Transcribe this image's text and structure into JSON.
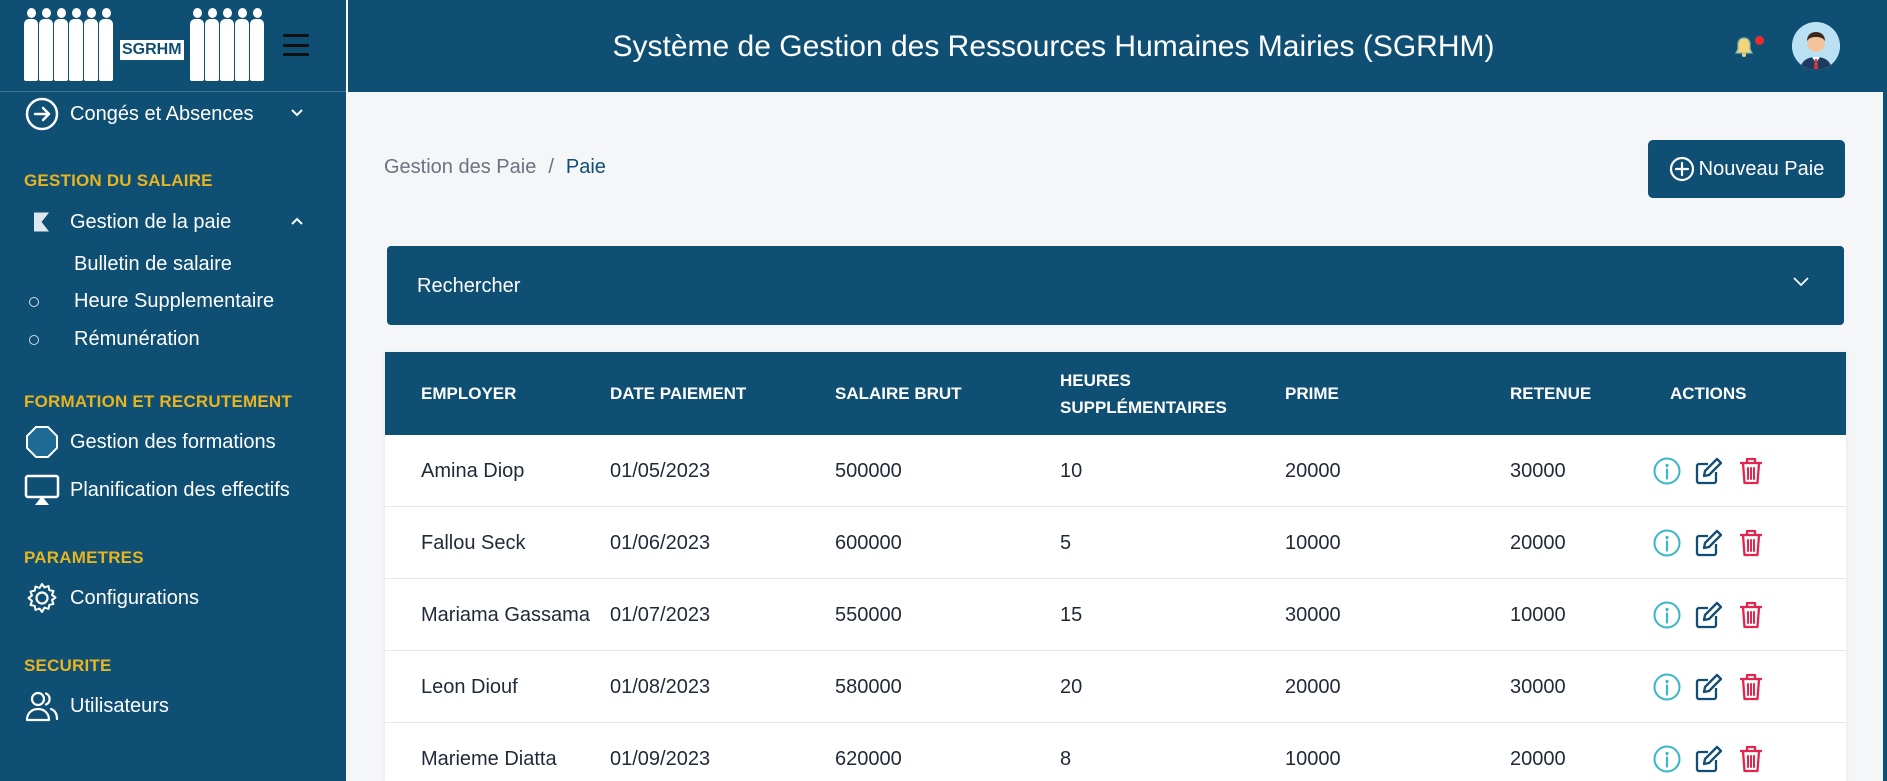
{
  "app": {
    "logo_text": "SGRHM",
    "title": "Système de Gestion des Ressources Humaines Mairies (SGRHM)"
  },
  "colors": {
    "primary": "#0e4f73",
    "section": "#e8b420",
    "info": "#36b7c7",
    "edit": "#0e4f73",
    "delete": "#e0264d",
    "notification": "#ef2b2b"
  },
  "sidebar": {
    "conges": "Congés et Absences",
    "sections": {
      "salaire": "GESTION DU SALAIRE",
      "formation": "FORMATION ET RECRUTEMENT",
      "parametres": "PARAMETRES",
      "securite": "SECURITE"
    },
    "paie": "Gestion de la paie",
    "sub_items": [
      "Bulletin de salaire",
      "Heure Supplementaire",
      "Rémunération"
    ],
    "formations": "Gestion des formations",
    "planification": "Planification des effectifs",
    "configurations": "Configurations",
    "utilisateurs": "Utilisateurs"
  },
  "breadcrumb": {
    "parent": "Gestion des Paie",
    "separator": "/",
    "current": "Paie"
  },
  "new_button": "Nouveau Paie",
  "search": {
    "label": "Rechercher"
  },
  "table": {
    "headers": [
      "EMPLOYER",
      "DATE PAIEMENT",
      "SALAIRE BRUT",
      "HEURES SUPPLÉMENTAIRES",
      "PRIME",
      "RETENUE",
      "ACTIONS"
    ],
    "rows": [
      [
        "Amina Diop",
        "01/05/2023",
        "500000",
        "10",
        "20000",
        "30000"
      ],
      [
        "Fallou Seck",
        "01/06/2023",
        "600000",
        "5",
        "10000",
        "20000"
      ],
      [
        "Mariama Gassama",
        "01/07/2023",
        "550000",
        "15",
        "30000",
        "10000"
      ],
      [
        "Leon Diouf",
        "01/08/2023",
        "580000",
        "20",
        "20000",
        "30000"
      ],
      [
        "Marieme Diatta",
        "01/09/2023",
        "620000",
        "8",
        "10000",
        "20000"
      ]
    ]
  }
}
